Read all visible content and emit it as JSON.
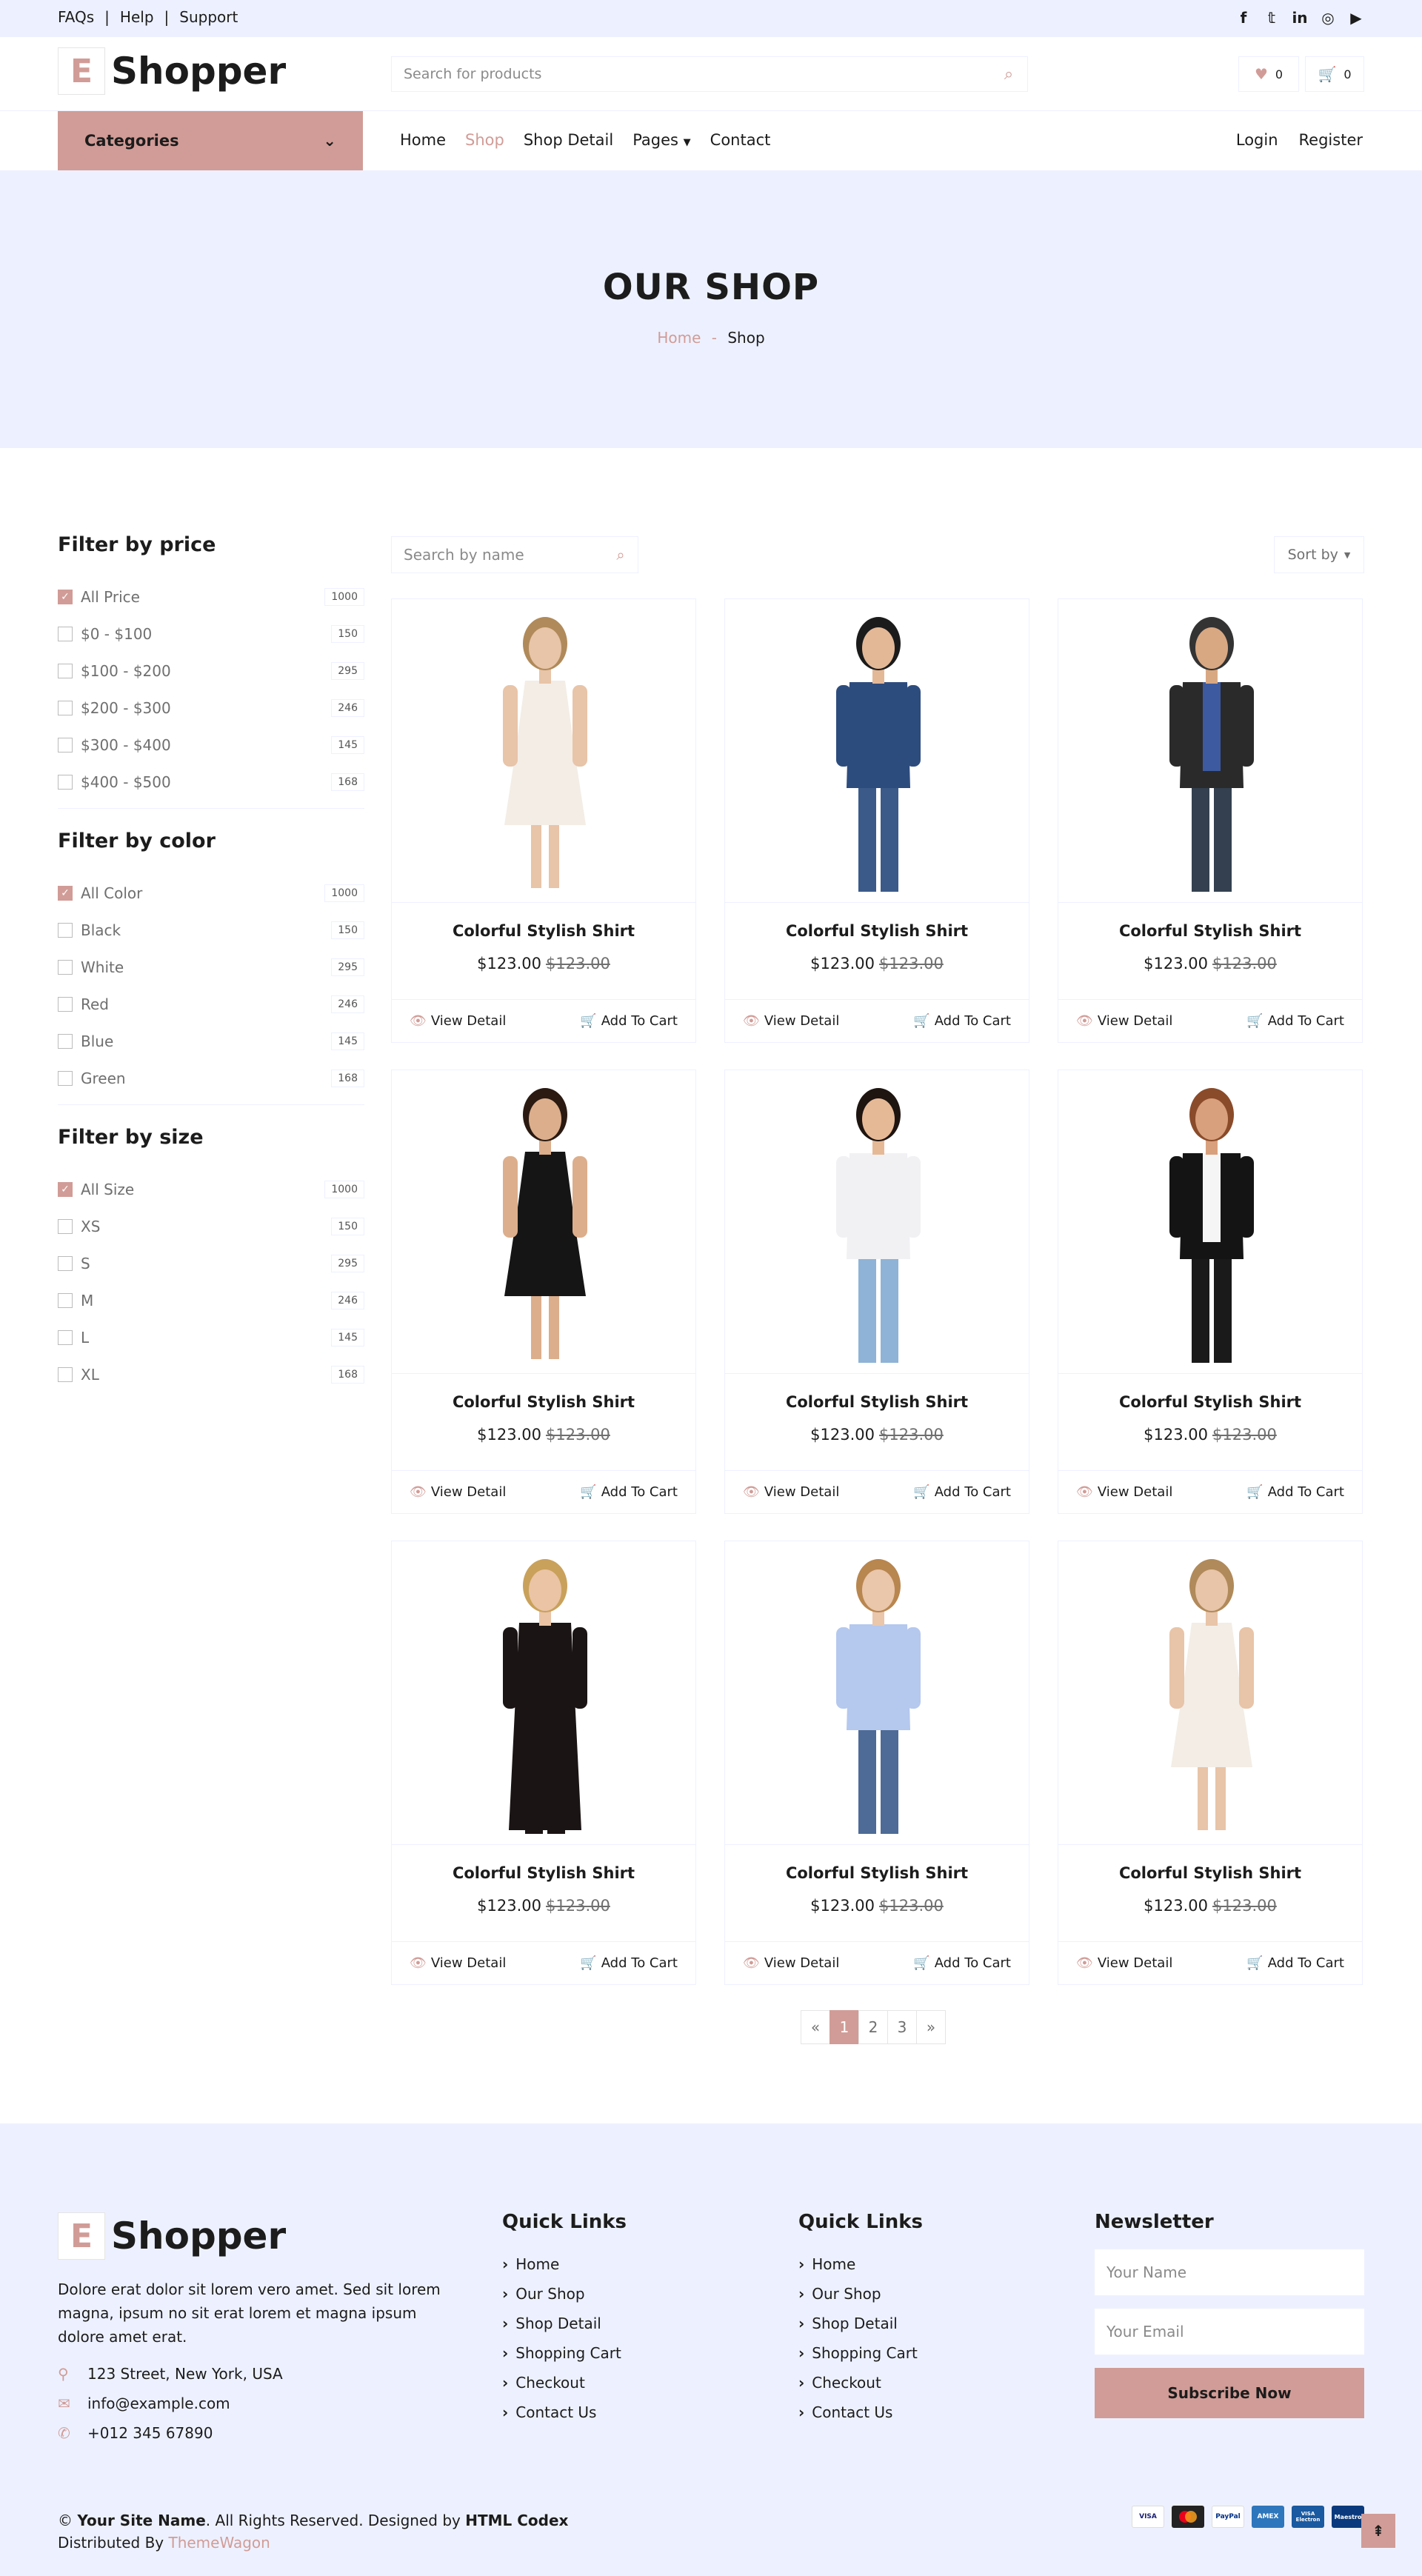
{
  "topbar": {
    "links": [
      "FAQs",
      "Help",
      "Support"
    ],
    "separator": "|"
  },
  "social": [
    "facebook-icon",
    "twitter-icon",
    "linkedin-icon",
    "instagram-icon",
    "youtube-icon"
  ],
  "brand": {
    "letter": "E",
    "name": "Shopper",
    "accent": "#d19c97",
    "light_bg": "#edf1ff"
  },
  "header": {
    "search_placeholder": "Search for products",
    "wishlist_count": "0",
    "cart_count": "0"
  },
  "nav": {
    "categories_label": "Categories",
    "links": [
      "Home",
      "Shop",
      "Shop Detail",
      "Pages",
      "Contact"
    ],
    "active": "Shop",
    "login": "Login",
    "register": "Register"
  },
  "hero": {
    "title": "OUR SHOP",
    "breadcrumb_home": "Home",
    "breadcrumb_sep": "-",
    "breadcrumb_current": "Shop"
  },
  "filters": [
    {
      "title": "Filter by price",
      "items": [
        {
          "label": "All Price",
          "count": "1000",
          "checked": true
        },
        {
          "label": "$0 - $100",
          "count": "150",
          "checked": false
        },
        {
          "label": "$100 - $200",
          "count": "295",
          "checked": false
        },
        {
          "label": "$200 - $300",
          "count": "246",
          "checked": false
        },
        {
          "label": "$300 - $400",
          "count": "145",
          "checked": false
        },
        {
          "label": "$400 - $500",
          "count": "168",
          "checked": false
        }
      ]
    },
    {
      "title": "Filter by color",
      "items": [
        {
          "label": "All Color",
          "count": "1000",
          "checked": true
        },
        {
          "label": "Black",
          "count": "150",
          "checked": false
        },
        {
          "label": "White",
          "count": "295",
          "checked": false
        },
        {
          "label": "Red",
          "count": "246",
          "checked": false
        },
        {
          "label": "Blue",
          "count": "145",
          "checked": false
        },
        {
          "label": "Green",
          "count": "168",
          "checked": false
        }
      ]
    },
    {
      "title": "Filter by size",
      "items": [
        {
          "label": "All Size",
          "count": "1000",
          "checked": true
        },
        {
          "label": "XS",
          "count": "150",
          "checked": false
        },
        {
          "label": "S",
          "count": "295",
          "checked": false
        },
        {
          "label": "M",
          "count": "246",
          "checked": false
        },
        {
          "label": "L",
          "count": "145",
          "checked": false
        },
        {
          "label": "XL",
          "count": "168",
          "checked": false
        }
      ]
    }
  ],
  "shop": {
    "search_placeholder": "Search by name",
    "sort_label": "Sort by"
  },
  "products": [
    {
      "name": "Colorful Stylish Shirt",
      "price": "$123.00",
      "old_price": "$123.00",
      "view": "View Detail",
      "cart": "Add To Cart",
      "image": "woman-white-dress"
    },
    {
      "name": "Colorful Stylish Shirt",
      "price": "$123.00",
      "old_price": "$123.00",
      "view": "View Detail",
      "cart": "Add To Cart",
      "image": "boy-denim-jacket"
    },
    {
      "name": "Colorful Stylish Shirt",
      "price": "$123.00",
      "old_price": "$123.00",
      "view": "View Detail",
      "cart": "Add To Cart",
      "image": "man-leather-jacket"
    },
    {
      "name": "Colorful Stylish Shirt",
      "price": "$123.00",
      "old_price": "$123.00",
      "view": "View Detail",
      "cart": "Add To Cart",
      "image": "woman-black-dress"
    },
    {
      "name": "Colorful Stylish Shirt",
      "price": "$123.00",
      "old_price": "$123.00",
      "view": "View Detail",
      "cart": "Add To Cart",
      "image": "girl-printed-shirt"
    },
    {
      "name": "Colorful Stylish Shirt",
      "price": "$123.00",
      "old_price": "$123.00",
      "view": "View Detail",
      "cart": "Add To Cart",
      "image": "man-tuxedo"
    },
    {
      "name": "Colorful Stylish Shirt",
      "price": "$123.00",
      "old_price": "$123.00",
      "view": "View Detail",
      "cart": "Add To Cart",
      "image": "woman-black-coat"
    },
    {
      "name": "Colorful Stylish Shirt",
      "price": "$123.00",
      "old_price": "$123.00",
      "view": "View Detail",
      "cart": "Add To Cart",
      "image": "boy-blue-shirt"
    },
    {
      "name": "Colorful Stylish Shirt",
      "price": "$123.00",
      "old_price": "$123.00",
      "view": "View Detail",
      "cart": "Add To Cart",
      "image": "woman-white-dress"
    }
  ],
  "pagination": {
    "prev": "«",
    "pages": [
      "1",
      "2",
      "3"
    ],
    "active": "1",
    "next": "»"
  },
  "footer": {
    "description": "Dolore erat dolor sit lorem vero amet. Sed sit lorem magna, ipsum no sit erat lorem et magna ipsum dolore amet erat.",
    "address": "123 Street, New York, USA",
    "email": "info@example.com",
    "phone": "+012 345 67890",
    "quick_links_title": "Quick Links",
    "quick_links": [
      "Home",
      "Our Shop",
      "Shop Detail",
      "Shopping Cart",
      "Checkout",
      "Contact Us"
    ],
    "newsletter_title": "Newsletter",
    "name_placeholder": "Your Name",
    "email_placeholder": "Your Email",
    "subscribe": "Subscribe Now",
    "copyright_prefix": "©",
    "site_name": "Your Site Name",
    "rights": ". All Rights Reserved. Designed by",
    "designer": "HTML Codex",
    "distributed_by": "Distributed By",
    "distributor": "ThemeWagon",
    "payments": [
      "VISA",
      "MC",
      "PayPal",
      "AMEX",
      "VISA Electron",
      "Maestro"
    ]
  }
}
